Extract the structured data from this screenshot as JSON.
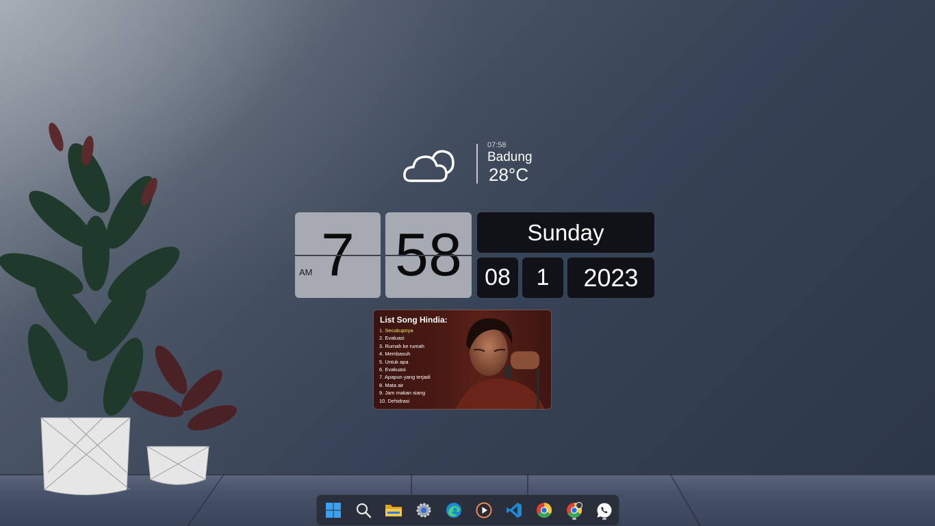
{
  "weather": {
    "time": "07:58",
    "city": "Badung",
    "temperature": "28°C",
    "condition_icon": "cloud-icon"
  },
  "clock": {
    "hour": "7",
    "minute": "58",
    "period": "AM"
  },
  "date": {
    "day_name": "Sunday",
    "day": "08",
    "month": "1",
    "year": "2023"
  },
  "music_widget": {
    "title": "List Song Hindia:",
    "songs": [
      "1. Secukupnya",
      "2. Evaluasi",
      "3. Rumah ke rumah",
      "4. Membasuh",
      "5. Untuk apa",
      "6. Evakuasi",
      "7. Apapun yang terjadi",
      "8. Mata air",
      "9. Jam makan siang",
      "10. Dehidrasi"
    ],
    "active_index": 0,
    "active_color": "#f3e36a"
  },
  "taskbar": {
    "items": [
      {
        "icon": "windows-start-icon"
      },
      {
        "icon": "search-icon"
      },
      {
        "icon": "file-explorer-icon"
      },
      {
        "icon": "settings-gear-icon"
      },
      {
        "icon": "edge-browser-icon"
      },
      {
        "icon": "media-player-icon"
      },
      {
        "icon": "vscode-icon"
      },
      {
        "icon": "chrome-icon"
      },
      {
        "icon": "chrome-profile-icon",
        "running": true
      },
      {
        "icon": "whatsapp-icon",
        "running": true
      }
    ]
  }
}
